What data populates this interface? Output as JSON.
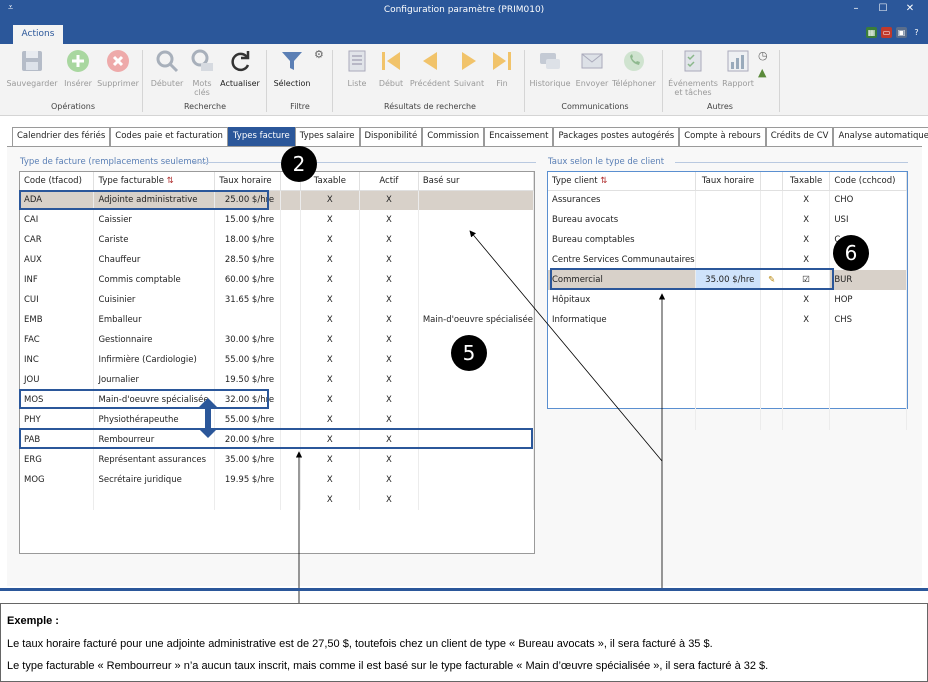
{
  "window": {
    "title": "Configuration paramètre (PRIM010)",
    "quick_access": "⩡",
    "controls": {
      "minimize": "–",
      "maximize": "☐",
      "close": "✕"
    }
  },
  "ribbon": {
    "tab": "Actions",
    "buttons": {
      "save": "Sauvegarder",
      "insert": "Insérer",
      "delete": "Supprimer",
      "start": "Débuter",
      "keywords": "Mots clés",
      "refresh": "Actualiser",
      "selection": "Sélection",
      "list": "Liste",
      "first": "Début",
      "previous": "Précédent",
      "next": "Suivant",
      "last": "Fin",
      "history": "Historique",
      "send": "Envoyer",
      "phone": "Téléphoner",
      "events": "Événements et tâches",
      "report": "Rapport"
    },
    "groups": {
      "operations": "Opérations",
      "search": "Recherche",
      "filter": "Filtre",
      "results": "Résultats de recherche",
      "communications": "Communications",
      "others": "Autres"
    }
  },
  "page_tabs": [
    "Calendrier des fériés",
    "Codes paie et facturation",
    "Types facture",
    "Types salaire",
    "Disponibilité",
    "Commission",
    "Encaissement",
    "Packages postes autogérés",
    "Compte à rebours",
    "Crédits de CV",
    "Analyse automatique de CV"
  ],
  "active_tab": "Types facture",
  "left_panel": {
    "label": "Type de facture (remplacements seulement)",
    "columns": [
      "Code (tfacod)",
      "Type facturable",
      "Taux horaire",
      "Taxable",
      "Actif",
      "Basé sur"
    ],
    "rows": [
      [
        "ADA",
        "Adjointe administrative",
        "25.00 $/hre",
        "X",
        "X",
        ""
      ],
      [
        "CAI",
        "Caissier",
        "15.00 $/hre",
        "X",
        "X",
        ""
      ],
      [
        "CAR",
        "Cariste",
        "18.00 $/hre",
        "X",
        "X",
        ""
      ],
      [
        "AUX",
        "Chauffeur",
        "28.50 $/hre",
        "X",
        "X",
        ""
      ],
      [
        "INF",
        "Commis comptable",
        "60.00 $/hre",
        "X",
        "X",
        ""
      ],
      [
        "CUI",
        "Cuisinier",
        "31.65 $/hre",
        "X",
        "X",
        ""
      ],
      [
        "EMB",
        "Emballeur",
        "",
        "X",
        "X",
        "Main-d'oeuvre spécialisée"
      ],
      [
        "FAC",
        "Gestionnaire",
        "30.00 $/hre",
        "X",
        "X",
        ""
      ],
      [
        "INC",
        "Infirmière (Cardiologie)",
        "55.00 $/hre",
        "X",
        "X",
        ""
      ],
      [
        "JOU",
        "Journalier",
        "19.50 $/hre",
        "X",
        "X",
        ""
      ],
      [
        "MOS",
        "Main-d'oeuvre spécialisée",
        "32.00 $/hre",
        "X",
        "X",
        ""
      ],
      [
        "PHY",
        "Physiothérapeuthe",
        "55.00 $/hre",
        "X",
        "X",
        ""
      ],
      [
        "PAB",
        "Rembourreur",
        "20.00 $/hre",
        "X",
        "X",
        ""
      ],
      [
        "ERG",
        "Représentant assurances",
        "35.00 $/hre",
        "X",
        "X",
        ""
      ],
      [
        "MOG",
        "Secrétaire juridique",
        "19.95 $/hre",
        "X",
        "X",
        ""
      ],
      [
        "",
        "",
        "",
        "X",
        "X",
        ""
      ]
    ]
  },
  "right_panel": {
    "label": "Taux selon le type de client",
    "columns": [
      "Type client",
      "Taux horaire",
      "Taxable",
      "Code (cchcod)"
    ],
    "rows": [
      [
        "Assurances",
        "",
        "X",
        "CHO"
      ],
      [
        "Bureau avocats",
        "",
        "X",
        "USI"
      ],
      [
        "Bureau comptables",
        "",
        "X",
        "C"
      ],
      [
        "Centre Services Communautaires",
        "",
        "X",
        ""
      ],
      [
        "Commercial",
        "35.00 $/hre",
        "☑",
        "BUR"
      ],
      [
        "Hôpitaux",
        "",
        "X",
        "HOP"
      ],
      [
        "Informatique",
        "",
        "X",
        "CHS"
      ]
    ]
  },
  "badges": [
    "2",
    "5",
    "6"
  ],
  "example": {
    "heading": "Exemple :",
    "line1": "Le taux horaire facturé pour une adjointe administrative est de 27,50 $, toutefois chez un client de type « Bureau avocats », il sera facturé à 35 $.",
    "line2": "Le type facturable « Rembourreur » n’a aucun taux inscrit, mais comme il est basé sur le type facturable « Main d’œuvre spécialisée », il sera facturé à 32 $."
  },
  "colors": {
    "accent": "#2b579a",
    "selected_row": "#d8d1c9"
  }
}
